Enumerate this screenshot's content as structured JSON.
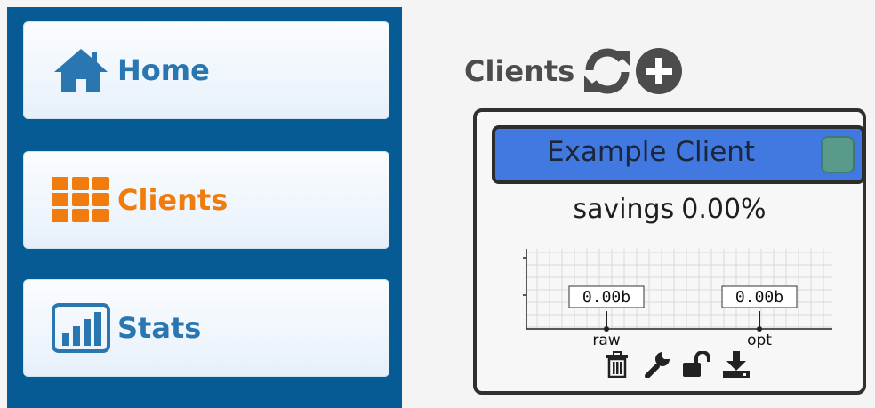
{
  "sidebar": {
    "items": [
      {
        "label": "Home",
        "icon": "home-icon",
        "color": "#2a76b0"
      },
      {
        "label": "Clients",
        "icon": "grid-icon",
        "color": "#f07c0d",
        "active": true
      },
      {
        "label": "Stats",
        "icon": "bar-chart-icon",
        "color": "#2a76b0"
      }
    ],
    "background": "#065b94"
  },
  "header": {
    "title": "Clients",
    "actions": [
      "refresh-icon",
      "add-icon"
    ]
  },
  "client_card": {
    "name": "Example Client",
    "savings_label": "savings",
    "savings_value": "0.00%",
    "bar_color": "#4179e0",
    "actions": [
      "trash-icon",
      "wrench-icon",
      "unlock-icon",
      "download-icon"
    ]
  },
  "chart_data": {
    "type": "bar",
    "categories": [
      "raw",
      "opt"
    ],
    "values": [
      0,
      0
    ],
    "data_labels": [
      "0.00b",
      "0.00b"
    ],
    "grid": true
  }
}
